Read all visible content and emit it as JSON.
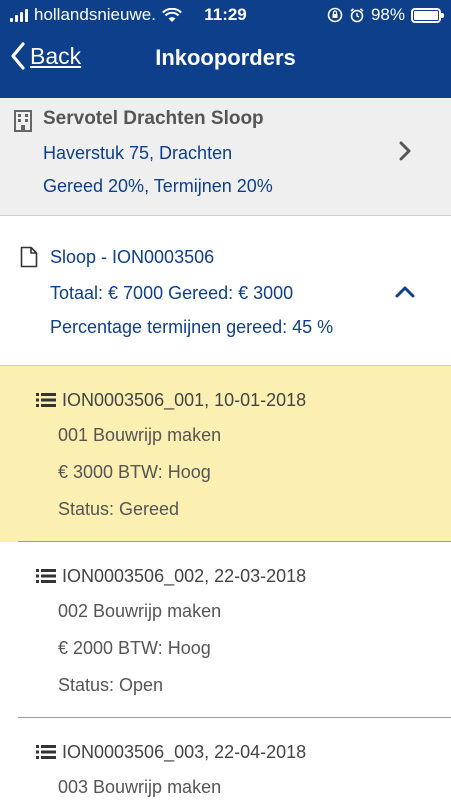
{
  "status_bar": {
    "carrier": "hollandsnieuwe.",
    "time": "11:29",
    "battery": "98%",
    "battery_level": 0.98,
    "icons": [
      "signal-icon",
      "wifi-icon",
      "orientation-lock-icon",
      "alarm-icon",
      "battery-icon"
    ]
  },
  "nav": {
    "back_label": "Back",
    "title": "Inkooporders"
  },
  "project": {
    "icon": "building-icon",
    "name": "Servotel Drachten Sloop",
    "address": "Haverstuk 75, Drachten",
    "status": "Gereed 20%, Termijnen 20%"
  },
  "order": {
    "icon": "document-icon",
    "name": "Sloop - ION0003506",
    "totals": "Totaal: € 7000 Gereed: € 3000",
    "percentage": "Percentage termijnen gereed: 45 %"
  },
  "lines": [
    {
      "header": "ION0003506_001, 10-01-2018",
      "description": "001 Bouwrijp maken",
      "amount": "€ 3000 BTW: Hoog",
      "status": "Status: Gereed",
      "highlighted": true
    },
    {
      "header": "ION0003506_002, 22-03-2018",
      "description": "002 Bouwrijp maken",
      "amount": "€ 2000 BTW: Hoog",
      "status": "Status: Open",
      "highlighted": false
    },
    {
      "header": "ION0003506_003, 22-04-2018",
      "description": "003 Bouwrijp maken",
      "amount": "",
      "status": "",
      "highlighted": false
    }
  ],
  "colors": {
    "brand": "#0d3f8a",
    "highlight": "#fbefb2",
    "project_bg": "#efefef"
  }
}
